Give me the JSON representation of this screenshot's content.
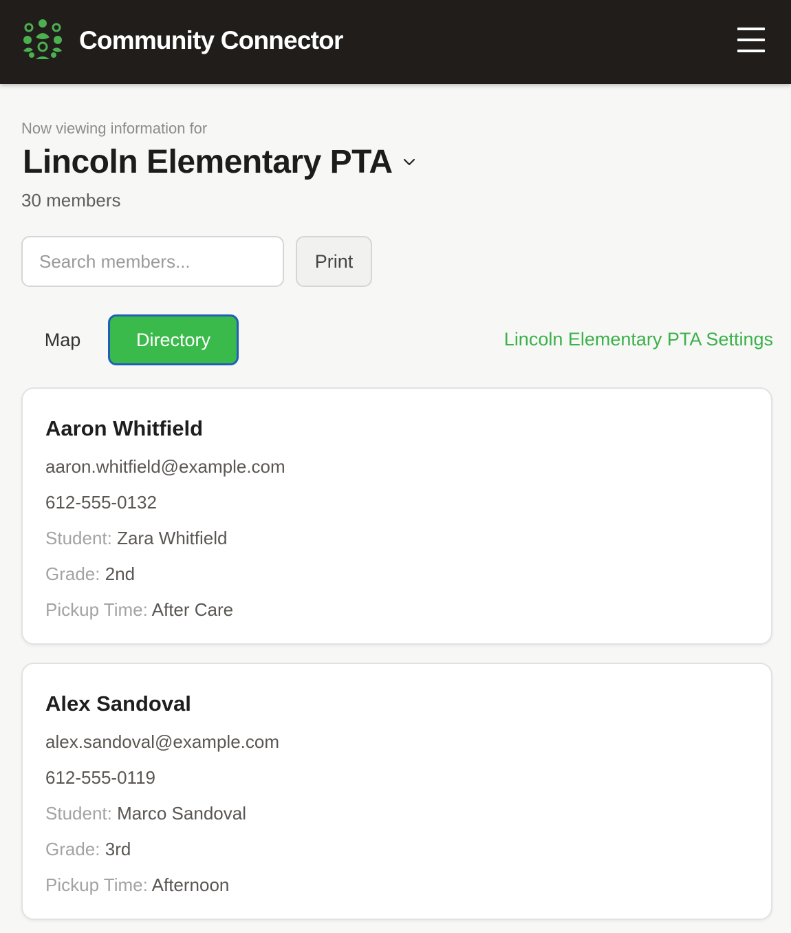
{
  "header": {
    "app_title": "Community Connector",
    "logo_icon": "community-logo-icon",
    "menu_icon": "hamburger-menu-icon",
    "background_color": "#201d1b"
  },
  "group": {
    "viewing_label": "Now viewing information for",
    "name": "Lincoln Elementary PTA",
    "member_count": "30 members"
  },
  "toolbar": {
    "search_placeholder": "Search members...",
    "print_label": "Print"
  },
  "tabs": {
    "map_label": "Map",
    "directory_label": "Directory",
    "active": "Directory",
    "settings_link": "Lincoln Elementary PTA Settings"
  },
  "labels": {
    "student": "Student:",
    "grade": "Grade:",
    "pickup": "Pickup Time:"
  },
  "members": [
    {
      "name": "Aaron Whitfield",
      "email": "aaron.whitfield@example.com",
      "phone": "612-555-0132",
      "student": "Zara Whitfield",
      "grade": "2nd",
      "pickup": "After Care"
    },
    {
      "name": "Alex Sandoval",
      "email": "alex.sandoval@example.com",
      "phone": "612-555-0119",
      "student": "Marco Sandoval",
      "grade": "3rd",
      "pickup": "Afternoon"
    }
  ],
  "colors": {
    "accent_green": "#3bba4c",
    "focus_blue": "#1f5fb8",
    "link_green": "#3bb14a"
  }
}
